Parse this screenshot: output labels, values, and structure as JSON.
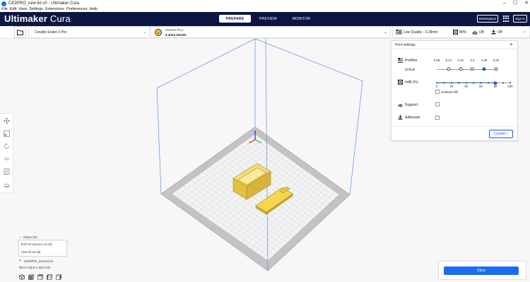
{
  "window": {
    "title": "CE3PRO_new lid v0 - Ultimaker Cura",
    "controls": [
      "–",
      "☐",
      "✕"
    ]
  },
  "menu": [
    "File",
    "Edit",
    "View",
    "Settings",
    "Extensions",
    "Preferences",
    "Help"
  ],
  "header": {
    "brand_bold": "Ultimaker",
    "brand_light": "Cura",
    "stages": [
      "PREPARE",
      "PREVIEW",
      "MONITOR"
    ],
    "marketplace": "Marketplace",
    "signin": "Sign in"
  },
  "toolbar": {
    "printer": "Creality Ender-3 Pro",
    "material": "Generic PLA",
    "nozzle": "0.4mm Nozzle",
    "nozzle_badge": "1",
    "quality": "Low Quality - 0.28mm",
    "infill": "80%",
    "support": "Off",
    "adhesion": "Off"
  },
  "print_settings": {
    "title": "Print settings",
    "profiles_label": "Profiles",
    "profile_name": "Default",
    "profile_ticks": [
      "0.08",
      "0.12",
      "0.16",
      "0.2",
      "0.28",
      "0.32"
    ],
    "profile_selected_index": 4,
    "infill_label": "Infill (%)",
    "infill_ticks": [
      "0",
      "20",
      "40",
      "60",
      "80",
      "100"
    ],
    "infill_value": 80,
    "gradual_infill_label": "Gradual infill",
    "support_label": "Support",
    "adhesion_label": "Adhesion",
    "custom_label": "Custom"
  },
  "object_list": {
    "header": "Object list",
    "items": [
      "ESP Enclosure v2.obj",
      "new lid v0.obj"
    ],
    "job_name": "CE3PRO_new lid v0",
    "dimensions": "90.0 x 63.9 x 29.0 mm"
  },
  "slice": {
    "label": "Slice"
  },
  "colors": {
    "header_bg": "#0d1642",
    "accent": "#196ef0",
    "model": "#f5d55c",
    "build_volume": "#5a8fe6"
  }
}
